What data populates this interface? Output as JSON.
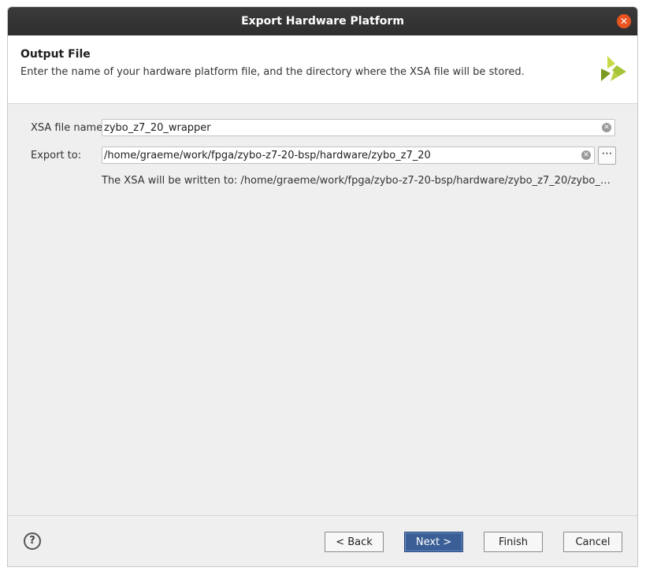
{
  "window": {
    "title": "Export Hardware Platform",
    "close_icon": "close-icon"
  },
  "header": {
    "title": "Output File",
    "description": "Enter the name of your hardware platform file, and the directory where the XSA file will be stored.",
    "logo": "xilinx-logo"
  },
  "form": {
    "xsa_label": "XSA file name:",
    "xsa_value": "zybo_z7_20_wrapper",
    "export_label": "Export to:",
    "export_value": "/home/graeme/work/fpga/zybo-z7-20-bsp/hardware/zybo_z7_20",
    "browse_label": "⋯",
    "note": "The XSA will be written to: /home/graeme/work/fpga/zybo-z7-20-bsp/hardware/zybo_z7_20/zybo_z7_20_w..."
  },
  "footer": {
    "help_label": "?",
    "back_label": "< Back",
    "next_label": "Next >",
    "finish_label": "Finish",
    "cancel_label": "Cancel"
  },
  "colors": {
    "titlebar": "#2e2e2e",
    "close": "#e95420",
    "primary_button": "#3a5f96",
    "logo_green": "#8dbf2b"
  }
}
